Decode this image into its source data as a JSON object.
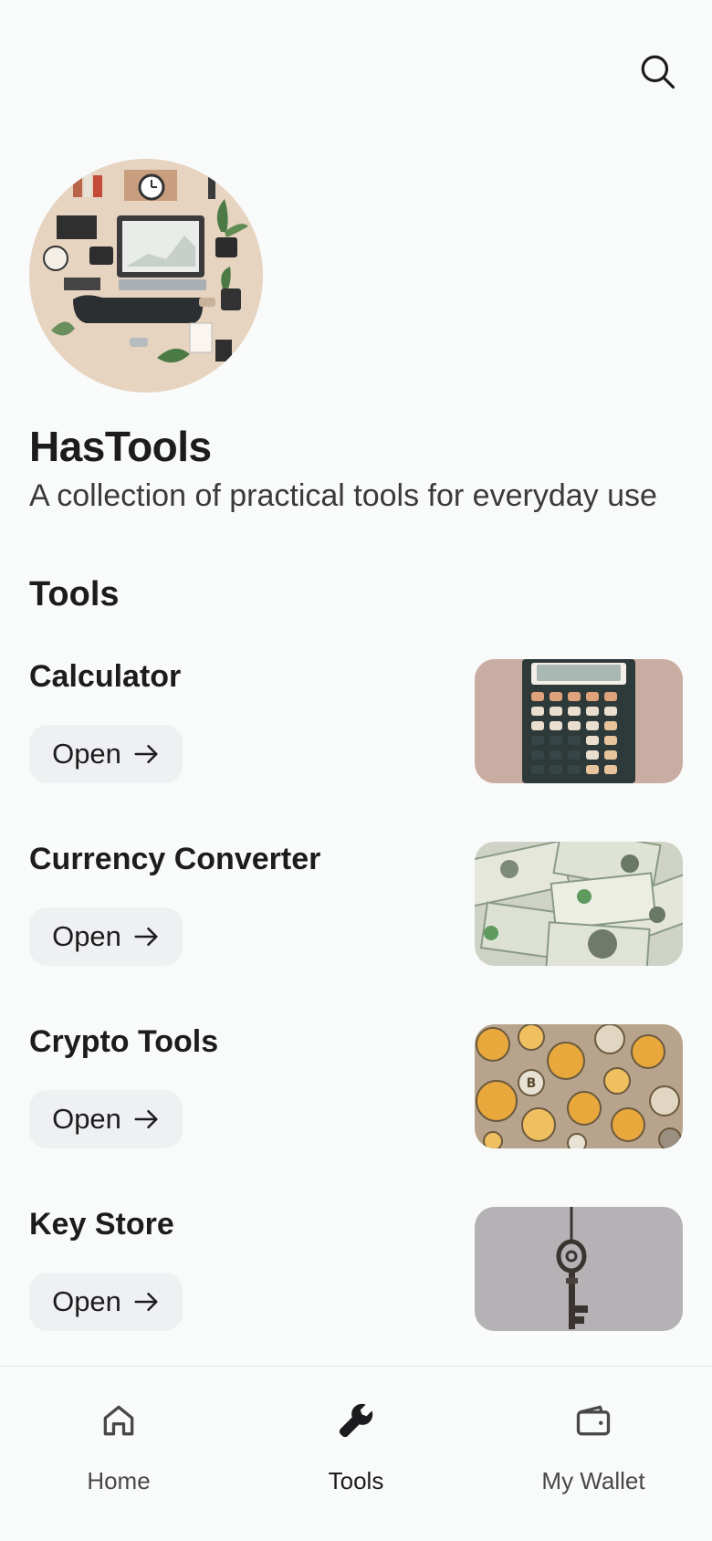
{
  "header": {
    "search_icon": "search-icon"
  },
  "app": {
    "title": "HasTools",
    "subtitle": "A collection of practical tools for everyday use"
  },
  "tools_section": {
    "title": "Tools",
    "items": [
      {
        "name": "Calculator",
        "button_label": "Open",
        "image": "calculator-image"
      },
      {
        "name": "Currency Converter",
        "button_label": "Open",
        "image": "currency-image"
      },
      {
        "name": "Crypto Tools",
        "button_label": "Open",
        "image": "crypto-coins-image"
      },
      {
        "name": "Key Store",
        "button_label": "Open",
        "image": "vintage-key-image"
      }
    ]
  },
  "bottom_nav": {
    "items": [
      {
        "label": "Home",
        "icon": "home-icon",
        "active": false
      },
      {
        "label": "Tools",
        "icon": "wrench-icon",
        "active": true
      },
      {
        "label": "My Wallet",
        "icon": "wallet-icon",
        "active": false
      }
    ]
  },
  "colors": {
    "background": "#f9fafa",
    "button_bg": "#eef0f1",
    "text": "#1c1c1e"
  }
}
